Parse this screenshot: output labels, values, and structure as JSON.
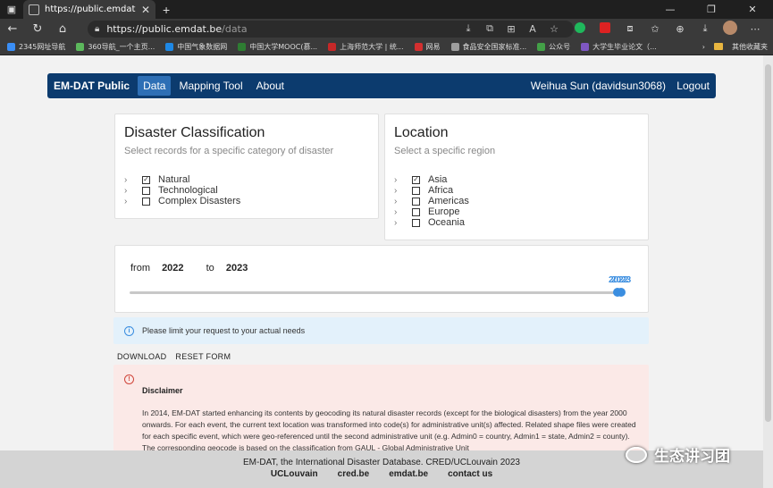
{
  "browser": {
    "tab_title": "https://public.emdat.be/data",
    "url_host": "https://public.emdat.be",
    "url_path": "/data",
    "bookmarks": [
      {
        "label": "2345网址导航",
        "color": "#3a8ef6"
      },
      {
        "label": "360导航_一个主页...",
        "color": "#5cb85c"
      },
      {
        "label": "中国气象数据网",
        "color": "#1e88e5"
      },
      {
        "label": "中国大学MOOC(慕...",
        "color": "#2e7d32"
      },
      {
        "label": "上海师范大学 | 统...",
        "color": "#c62828"
      },
      {
        "label": "网易",
        "color": "#d32f2f"
      },
      {
        "label": "食品安全国家标准...",
        "color": "#9e9e9e"
      },
      {
        "label": "公众号",
        "color": "#43a047"
      },
      {
        "label": "大学生毕业论文（...",
        "color": "#7e57c2"
      }
    ],
    "other_bookmarks": "其他收藏夹"
  },
  "navbar": {
    "brand": "EM-DAT Public",
    "links": [
      "Data",
      "Mapping Tool",
      "About"
    ],
    "user": "Weihua Sun (davidsun3068)",
    "logout": "Logout"
  },
  "classification": {
    "title": "Disaster Classification",
    "subtitle": "Select records for a specific category of disaster",
    "items": [
      {
        "label": "Natural",
        "checked": true
      },
      {
        "label": "Technological",
        "checked": false
      },
      {
        "label": "Complex Disasters",
        "checked": false
      }
    ]
  },
  "location": {
    "title": "Location",
    "subtitle": "Select a specific region",
    "items": [
      {
        "label": "Asia",
        "checked": true
      },
      {
        "label": "Africa",
        "checked": false
      },
      {
        "label": "Americas",
        "checked": false
      },
      {
        "label": "Europe",
        "checked": false
      },
      {
        "label": "Oceania",
        "checked": false
      }
    ]
  },
  "period": {
    "from_label": "from",
    "from_value": "2022",
    "to_label": "to",
    "to_value": "2023",
    "slider_labels": [
      "2022",
      "2023"
    ]
  },
  "info": {
    "icon": "info-icon",
    "text": "Please limit your request to your actual needs"
  },
  "actions": {
    "download": "DOWNLOAD",
    "reset": "RESET FORM"
  },
  "disclaimer": {
    "title": "Disclaimer",
    "text": "In 2014, EM-DAT started enhancing its contents by geocoding its natural disaster records (except for the biological disasters) from the year 2000 onwards. For each event, the current text location was transformed into code(s) for administrative unit(s) affected. Related shape files were created for each specific event, which were geo-referenced until the second administrative unit (e.g. Admin0 = country, Admin1 = state, Admin2 = county). The corresponding geocode is based on the classification from GAUL - Global Administrative Unit"
  },
  "footer": {
    "line": "EM-DAT, the International Disaster Database. CRED/UCLouvain 2023",
    "links": [
      "UCLouvain",
      "cred.be",
      "emdat.be",
      "contact us"
    ]
  },
  "watermark": "生态讲习团"
}
